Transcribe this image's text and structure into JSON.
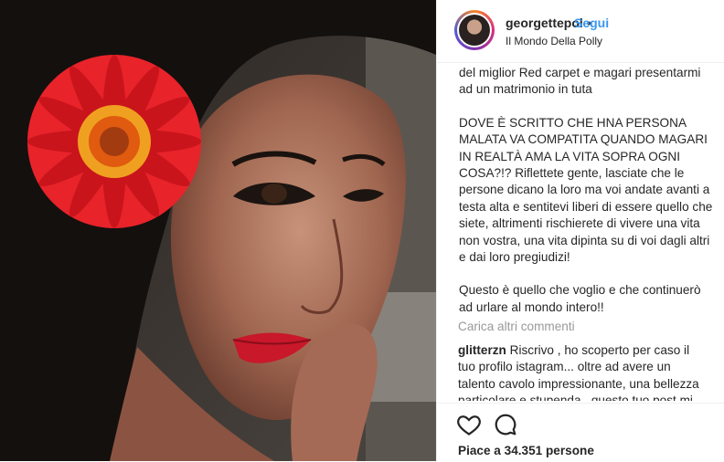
{
  "post": {
    "username": "georgettepol",
    "separator": "•",
    "follow_label": "Segui",
    "location": "Il Mondo Della Polly"
  },
  "caption": {
    "line1": "del miglior Red carpet e magari presentarmi ad un matrimonio in tuta",
    "para2": "DOVE È SCRITTO CHE HNA PERSONA MALATA VA COMPATITA QUANDO MAGARI IN REALTÀ AMA LA VITA SOPRA OGNI COSA?!? Riflettete gente, lasciate che le persone dicano la loro ma voi andate avanti a testa alta e sentitevi liberi di essere quello che siete, altrimenti rischierete di vivere una vita non vostra, una vita dipinta su di voi dagli altri e dai loro pregiudizi!",
    "para3": "Questo è quello che voglio e che continuerò ad urlare al mondo intero!!"
  },
  "load_more_label": "Carica altri commenti",
  "comment": {
    "username": "glitterzn",
    "text": "Riscrivo , ho scoperto per caso il tuo profilo istagram... oltre ad avere un talento cavolo impressionante, una bellezza particolare e stupenda , questo tuo post mi"
  },
  "likes_text": "Piace a 34.351 persone",
  "icons": {
    "like": "heart-icon",
    "comment": "comment-icon"
  },
  "colors": {
    "accent": "#3897f0",
    "text": "#262626",
    "muted": "#999999",
    "flower": "#e8232a"
  }
}
